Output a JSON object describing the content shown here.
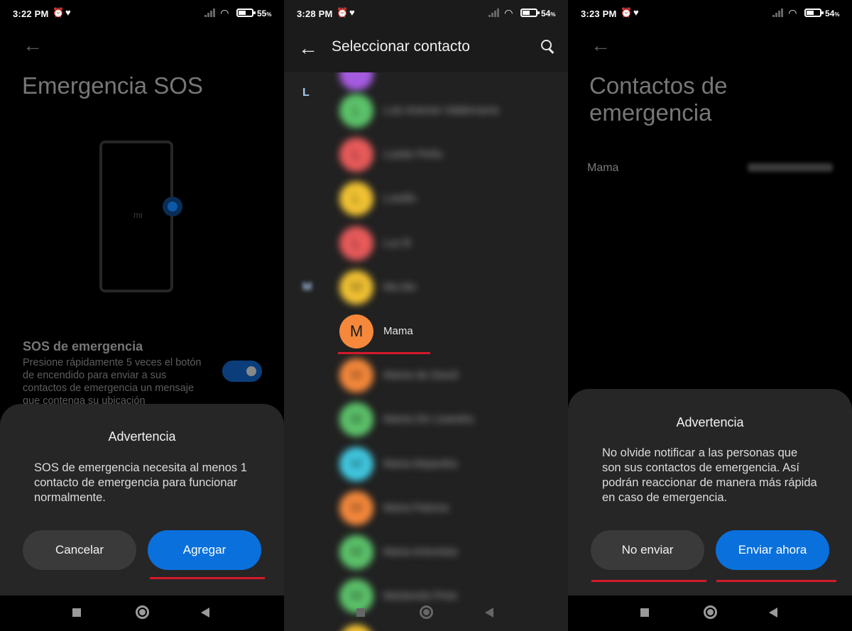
{
  "panel1": {
    "status": {
      "time": "3:22 PM",
      "battery_pct": "55",
      "battery_level": 0.55
    },
    "title": "Emergencia SOS",
    "illustration_label": "mi",
    "sos_title": "SOS de emergencia",
    "sos_desc": "Presione rápidamente 5 veces el botón de encendido para enviar a sus contactos de emergencia un mensaje que contenga su ubicación",
    "toggle_on": true,
    "dialog": {
      "title": "Advertencia",
      "message": "SOS de emergencia necesita al menos 1 contacto de emergencia para funcionar normalmente.",
      "cancel_label": "Cancelar",
      "confirm_label": "Agregar"
    }
  },
  "panel2": {
    "status": {
      "time": "3:28 PM",
      "battery_pct": "54",
      "battery_level": 0.54
    },
    "title": "Seleccionar contacto",
    "letters": [
      "L",
      "M"
    ],
    "contacts": [
      {
        "initial": "L",
        "name": "Luis Antonio Valderrama",
        "color": "#5cc26a",
        "blur": true
      },
      {
        "initial": "L",
        "name": "Luisito Peña",
        "color": "#e85a5a",
        "blur": true
      },
      {
        "initial": "L",
        "name": "Luisillo",
        "color": "#f1c232",
        "blur": true
      },
      {
        "initial": "L",
        "name": "Luz B",
        "color": "#e85a5a",
        "blur": true
      },
      {
        "initial": "M",
        "name": "Ma Ale",
        "color": "#f1c232",
        "blur": true
      },
      {
        "initial": "M",
        "name": "Mama",
        "color": "#f5883b",
        "blur": false
      },
      {
        "initial": "M",
        "name": "Mama de David",
        "color": "#f5883b",
        "blur": true
      },
      {
        "initial": "M",
        "name": "Mama De Lisandra",
        "color": "#5cc26a",
        "blur": true
      },
      {
        "initial": "M",
        "name": "Maria Alejandra",
        "color": "#40c8e0",
        "blur": true
      },
      {
        "initial": "M",
        "name": "Maria Patricia",
        "color": "#f5883b",
        "blur": true
      },
      {
        "initial": "M",
        "name": "Maria Antonieta",
        "color": "#5cc26a",
        "blur": true
      },
      {
        "initial": "M",
        "name": "Marlanela Pinto",
        "color": "#5cc26a",
        "blur": true
      }
    ]
  },
  "panel3": {
    "status": {
      "time": "3:23 PM",
      "battery_pct": "54",
      "battery_level": 0.54
    },
    "title_line1": "Contactos de",
    "title_line2": "emergencia",
    "contact_name": "Mama",
    "dialog": {
      "title": "Advertencia",
      "message": "No olvide notificar a las personas que son sus contactos de emergencia. Así podrán reaccionar de manera más rápida en caso de emergencia.",
      "cancel_label": "No enviar",
      "confirm_label": "Enviar ahora"
    }
  },
  "icons": {
    "back": "back-arrow-icon",
    "search": "search-icon",
    "alarm": "alarm-icon",
    "app": "app-notification-icon",
    "signal": "signal-icon",
    "wifi": "wifi-icon",
    "battery": "battery-icon"
  },
  "colors": {
    "accent_blue": "#0a70dc",
    "highlight_red": "#d4192b",
    "sheet_bg": "#262626"
  }
}
